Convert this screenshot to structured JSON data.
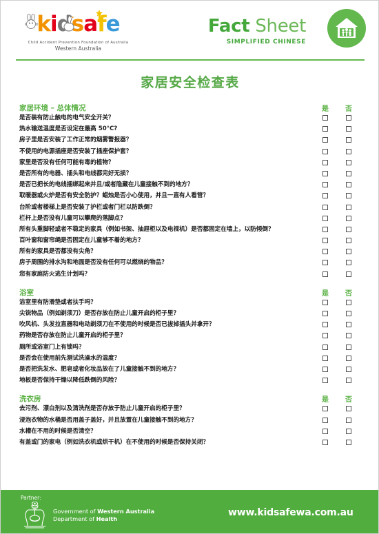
{
  "header": {
    "logo": {
      "letters": [
        {
          "char": "k",
          "color": "#f39200"
        },
        {
          "char": "i",
          "color": "#e2001a"
        },
        {
          "char": "d",
          "color": "#7a7a7a"
        },
        {
          "char": "s",
          "color": "#f39200"
        },
        {
          "char": "a",
          "color": "#e2001a"
        },
        {
          "char": "f",
          "color": "#f2c200"
        },
        {
          "char": "e",
          "color": "#3a9ad9"
        }
      ],
      "tagline_1": "Child Accident Prevention Foundation of Australia",
      "tagline_2": "Western Australia"
    },
    "fact_bold": "Fact",
    "fact_light": " Sheet",
    "language_label": "SIMPLIFIED CHINESE",
    "badge_icon": "house-family-icon",
    "accent_color": "#62b74d"
  },
  "title": "家居安全检查表",
  "columns": {
    "yes": "是",
    "no": "否"
  },
  "sections": [
    {
      "title": "家居环境 – 总体情况",
      "items": [
        "是否装有防止触电的电气安全开关？",
        "热水输送温度是否设定在最高 50°C?",
        "房子里是否安装了工作正常的烟雾警报器？",
        "不使用的电源插座是否安装了插座保护套？",
        "家里是否没有任何可能有毒的植物？",
        "是否所有的电器、插头和电线都完好无损？",
        "是否已把长的电线捆绑起来并且/或者隐藏在儿童接触不到的地方？",
        "取暖器或火炉是否有安全防护？蜡烛是否小心使用，并且一直有人看管？",
        "台阶或者楼梯上是否安装了护栏或者门栏以防跌倒？",
        "栏杆上是否没有儿童可以攀爬的落脚点？",
        "所有头重脚轻或者不稳定的家具（例如书架、抽屉柜以及电视机）是否都固定在墙上，以防倾倒？",
        "百叶窗和窗帘绳是否固定在儿童够不着的地方？",
        "所有的家具是否都没有尖角？",
        "房子周围的排水沟和地面是否没有任何可以燃烧的物品？",
        "您有家庭防火逃生计划吗？"
      ]
    },
    {
      "title": "浴室",
      "items": [
        "浴室里有防滑垫或者扶手吗？",
        "尖锐物品（例如剃须刀）是否存放在防止儿童开启的柜子里？",
        "吹风机、头发拉直器和电动剃须刀在不使用的时候是否已拔掉插头并拿开？",
        "药物是否存放在防止儿童开启的柜子里？",
        "厕所或浴室门上有锁吗？",
        "是否会在使用前先测试洗澡水的温度？",
        "是否把洗发水、肥皂或者化妆品放在了儿童接触不到的地方？",
        "地板是否保持干燥以降低跌倒的风险？"
      ]
    },
    {
      "title": "洗衣房",
      "items": [
        "去污剂、漂白剂以及清洗剂是否存放于防止儿童开启的柜子里？",
        "浸泡衣物的水桶是否用盖子盖好，并且放置在儿童接触不到的地方？",
        "水槽在不用的时候是否清空？",
        "有盖或门的家电（例如洗衣机或烘干机）在不使用的时候是否保持关闭？"
      ]
    }
  ],
  "footer": {
    "partner_label": "Partner:",
    "crest_icon": "wa-government-crest-icon",
    "gov_line_1_plain": "Government of ",
    "gov_line_1_bold": "Western Australia",
    "gov_line_2_plain": "Department of ",
    "gov_line_2_bold": "Health",
    "website": "www.kidsafewa.com.au",
    "background_color": "#52ad3f"
  }
}
